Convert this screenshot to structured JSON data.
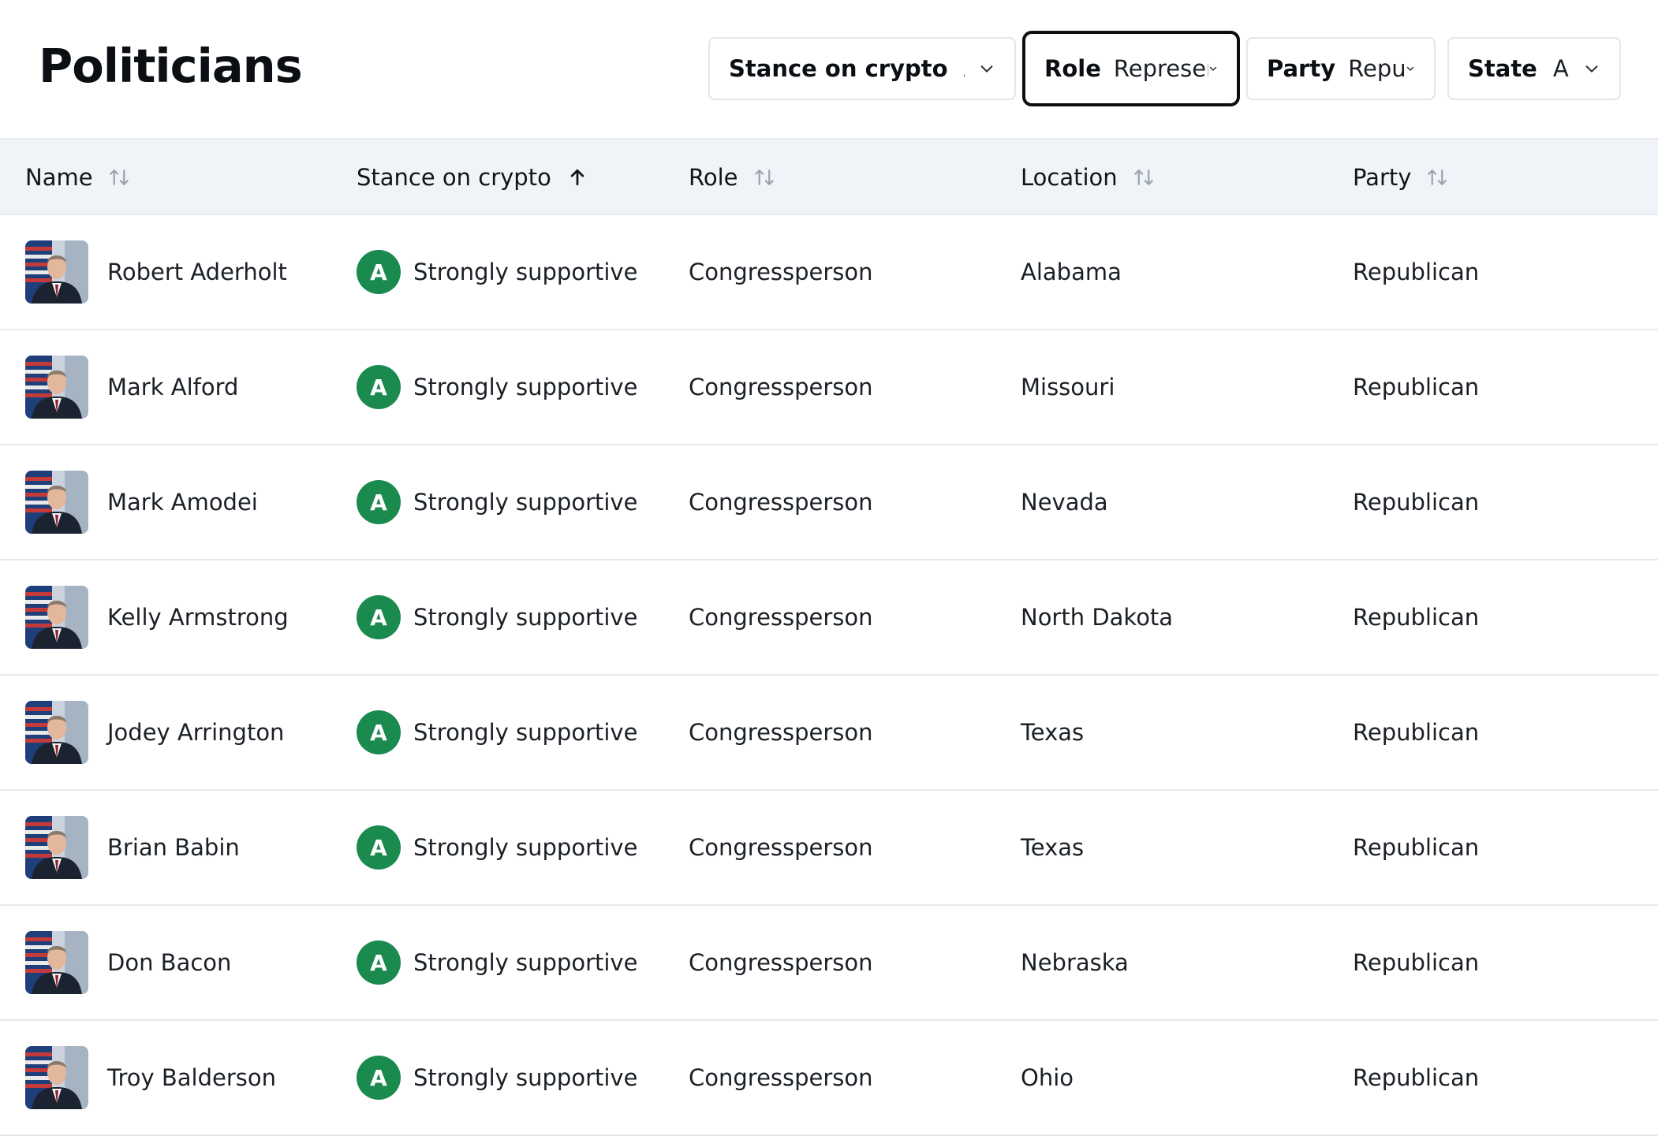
{
  "page": {
    "title": "Politicians"
  },
  "filters": [
    {
      "label": "Stance on crypto",
      "value": "All"
    },
    {
      "label": "Role",
      "value": "Represer"
    },
    {
      "label": "Party",
      "value": "Repub"
    },
    {
      "label": "State",
      "value": "All"
    }
  ],
  "table": {
    "columns": [
      {
        "label": "Name",
        "sort": "none"
      },
      {
        "label": "Stance on crypto",
        "sort": "ascending"
      },
      {
        "label": "Role",
        "sort": "none"
      },
      {
        "label": "Location",
        "sort": "none"
      },
      {
        "label": "Party",
        "sort": "none"
      }
    ],
    "rows": [
      {
        "name": "Robert Aderholt",
        "grade": "A",
        "stance": "Strongly supportive",
        "role": "Congressperson",
        "location": "Alabama",
        "party": "Republican"
      },
      {
        "name": "Mark Alford",
        "grade": "A",
        "stance": "Strongly supportive",
        "role": "Congressperson",
        "location": "Missouri",
        "party": "Republican"
      },
      {
        "name": "Mark Amodei",
        "grade": "A",
        "stance": "Strongly supportive",
        "role": "Congressperson",
        "location": "Nevada",
        "party": "Republican"
      },
      {
        "name": "Kelly Armstrong",
        "grade": "A",
        "stance": "Strongly supportive",
        "role": "Congressperson",
        "location": "North Dakota",
        "party": "Republican"
      },
      {
        "name": "Jodey Arrington",
        "grade": "A",
        "stance": "Strongly supportive",
        "role": "Congressperson",
        "location": "Texas",
        "party": "Republican"
      },
      {
        "name": "Brian Babin",
        "grade": "A",
        "stance": "Strongly supportive",
        "role": "Congressperson",
        "location": "Texas",
        "party": "Republican"
      },
      {
        "name": "Don Bacon",
        "grade": "A",
        "stance": "Strongly supportive",
        "role": "Congressperson",
        "location": "Nebraska",
        "party": "Republican"
      },
      {
        "name": "Troy Balderson",
        "grade": "A",
        "stance": "Strongly supportive",
        "role": "Congressperson",
        "location": "Ohio",
        "party": "Republican"
      }
    ]
  },
  "colors": {
    "grade_a": "#1a8a4f",
    "header_bg": "#f0f4f8",
    "text": "#111418"
  },
  "icons": {
    "sort": "sort-arrows-icon",
    "sort_asc": "arrow-up-icon",
    "dropdown": "chevron-down-icon",
    "avatar": "flag-portrait"
  }
}
